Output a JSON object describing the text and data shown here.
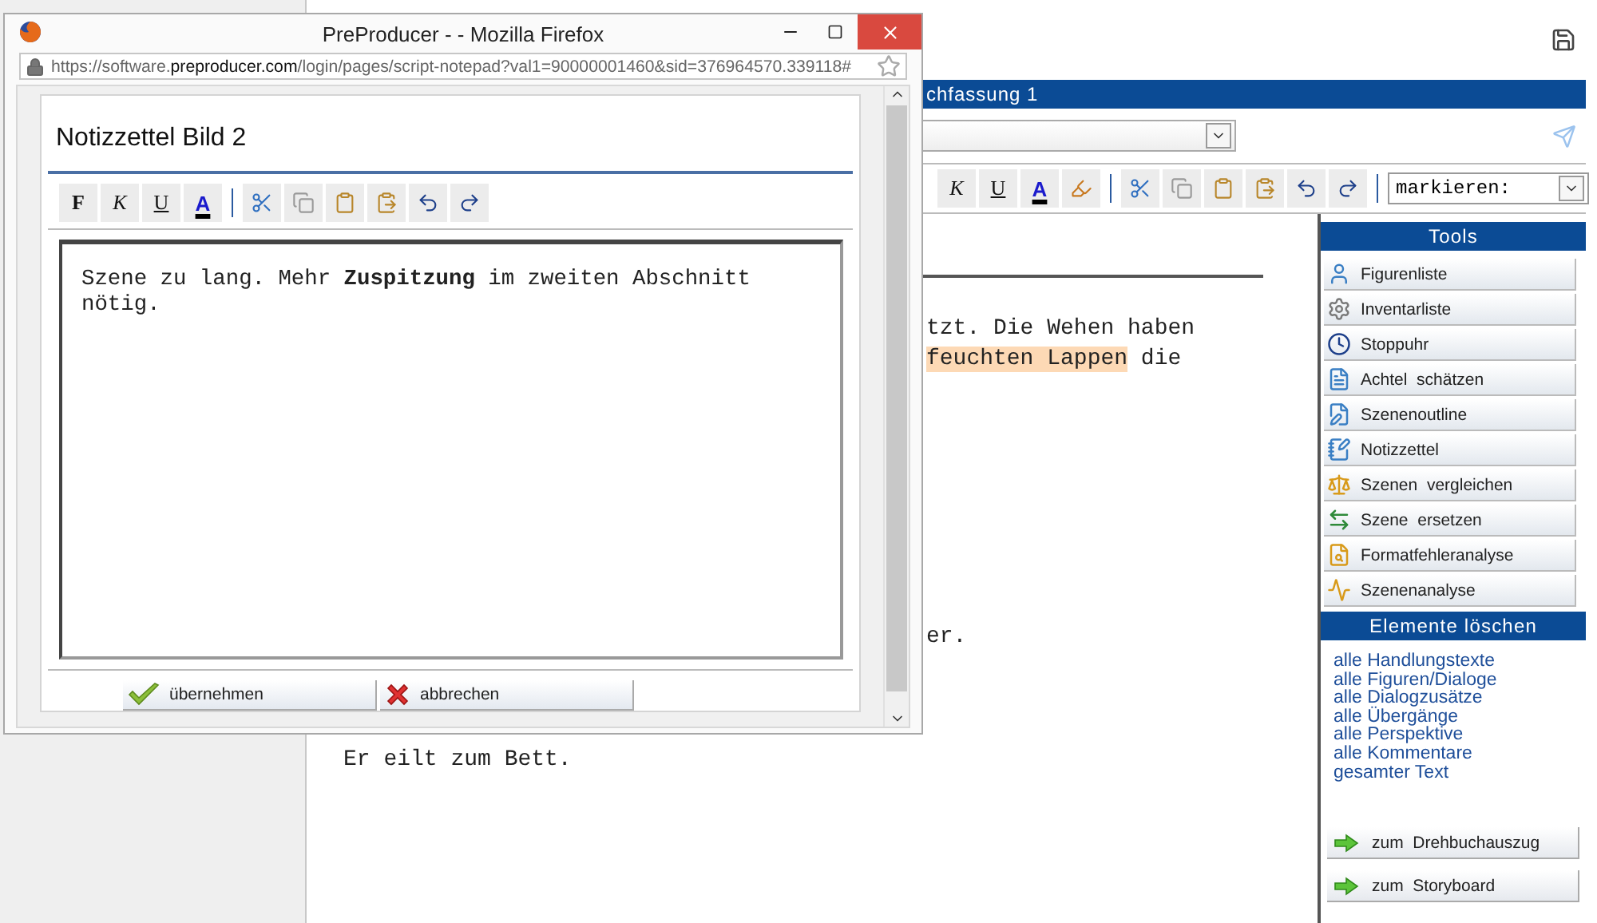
{
  "popup": {
    "title": "PreProducer - - Mozilla Firefox",
    "url": "https://software.**preproducer.com**/login/pages/script-notepad?val1=90000001460&sid=376964570.339118#",
    "heading": "Notizzettel Bild 2",
    "toolbar": [
      {
        "kind": "bold",
        "label": "F"
      },
      {
        "kind": "italic",
        "label": "K"
      },
      {
        "kind": "underline",
        "label": "U"
      },
      {
        "kind": "color",
        "label": "A"
      },
      {
        "kind": "separator"
      },
      {
        "kind": "cut"
      },
      {
        "kind": "copy"
      },
      {
        "kind": "paste"
      },
      {
        "kind": "paste_word"
      },
      {
        "kind": "undo"
      },
      {
        "kind": "redo"
      }
    ],
    "note": {
      "value": "Szene zu lang. Mehr **Zuspitzung** im zweiten Abschnitt nötig."
    },
    "buttons": [
      {
        "kind": "confirm",
        "label": "übernehmen"
      },
      {
        "kind": "cancel",
        "label": "abbrechen"
      }
    ]
  },
  "document": {
    "title_bar": "chfassung 1",
    "format_toolbar": [
      {
        "kind": "italic",
        "label": "K"
      },
      {
        "kind": "underline",
        "label": "U"
      },
      {
        "kind": "color",
        "label": "A"
      },
      {
        "kind": "highlight"
      },
      {
        "kind": "separator"
      },
      {
        "kind": "cut"
      },
      {
        "kind": "copy"
      },
      {
        "kind": "paste"
      },
      {
        "kind": "paste_word"
      },
      {
        "kind": "undo"
      },
      {
        "kind": "redo"
      },
      {
        "kind": "separator"
      }
    ],
    "mark_select": {
      "value": "markieren:"
    },
    "paragraphs": [
      {
        "lines": [
          [
            {
              "text": "tzt. Die Wehen haben",
              "highlighted": false
            }
          ],
          [
            {
              "text": "feuchten Lappen",
              "highlighted": true
            },
            {
              "text": " die",
              "highlighted": false
            }
          ]
        ]
      },
      {
        "lines": [
          [
            {
              "text": "er.",
              "highlighted": false
            }
          ]
        ]
      },
      {
        "lines": [
          [
            {
              "text": "Er eilt zum Bett.",
              "highlighted": false
            }
          ]
        ]
      }
    ]
  },
  "tools": {
    "title": "Tools",
    "items": [
      {
        "kind": "person",
        "label": "Figurenliste"
      },
      {
        "kind": "gear",
        "label": "Inventarliste"
      },
      {
        "kind": "clock",
        "label": "Stoppuhr"
      },
      {
        "kind": "fraction",
        "label": "Achtel  schätzen"
      },
      {
        "kind": "outline",
        "label": "Szenenoutline"
      },
      {
        "kind": "note",
        "label": "Notizzettel"
      },
      {
        "kind": "scales",
        "label": "Szenen  vergleichen"
      },
      {
        "kind": "swap",
        "label": "Szene  ersetzen"
      },
      {
        "kind": "format",
        "label": "Formatfehleranalyse"
      },
      {
        "kind": "analysis",
        "label": "Szenenanalyse"
      }
    ]
  },
  "delete_elements": {
    "title": "Elemente löschen",
    "links": [
      "alle Handlungstexte",
      "alle Figuren/Dialoge",
      "alle Dialogzusätze",
      "alle Übergänge",
      "alle Perspektive",
      "alle Kommentare",
      "gesamter Text"
    ]
  },
  "nav_buttons": [
    "zum  Drehbuchauszug",
    "zum  Storyboard"
  ]
}
